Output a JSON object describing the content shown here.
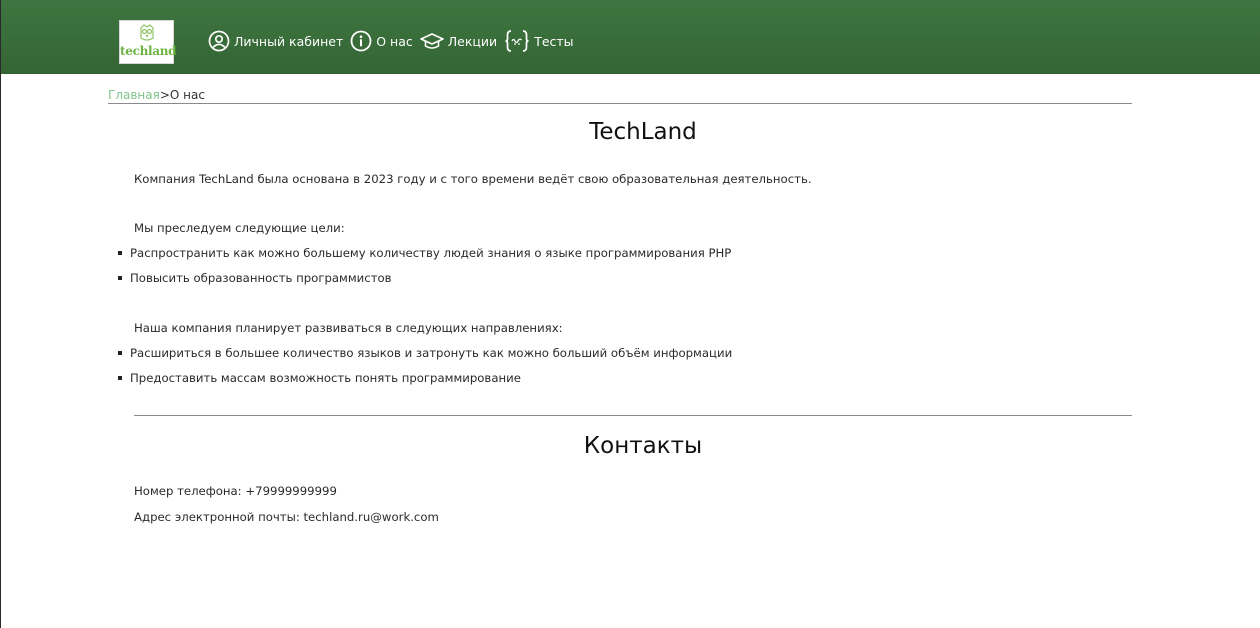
{
  "header": {
    "logo_text": "techland",
    "nav": [
      {
        "icon": "user-circle-icon",
        "label": "Личный кабинет"
      },
      {
        "icon": "info-icon",
        "label": "О нас"
      },
      {
        "icon": "graduation-cap-icon",
        "label": "Лекции"
      },
      {
        "icon": "braces-icon",
        "label": "Тесты"
      }
    ]
  },
  "breadcrumb": {
    "home": "Главная",
    "separator": ">",
    "current": "О нас"
  },
  "about": {
    "title": "TechLand",
    "intro": "Компания TechLand была основана в 2023 году и с того времени ведёт свою образовательная деятельность.",
    "goals_heading": "Мы преследуем следующие цели:",
    "goals": [
      "Распространить как можно большему количеству людей знания о языке программирования PHP",
      "Повысить образованность программистов"
    ],
    "directions_heading": "Наша компания планирует развиваться в следующих направлениях:",
    "directions": [
      "Расшириться в большее количество языков и затронуть как можно больший объём информации",
      "Предоставить массам возможность понять программирование"
    ]
  },
  "contacts": {
    "title": "Контакты",
    "phone": "Номер телефона: +79999999999",
    "email": "Адрес электронной почты: techland.ru@work.com"
  },
  "colors": {
    "header_bg": "#3a6e3b",
    "breadcrumb_link": "#7fc48a",
    "logo_green": "#6bb441"
  }
}
